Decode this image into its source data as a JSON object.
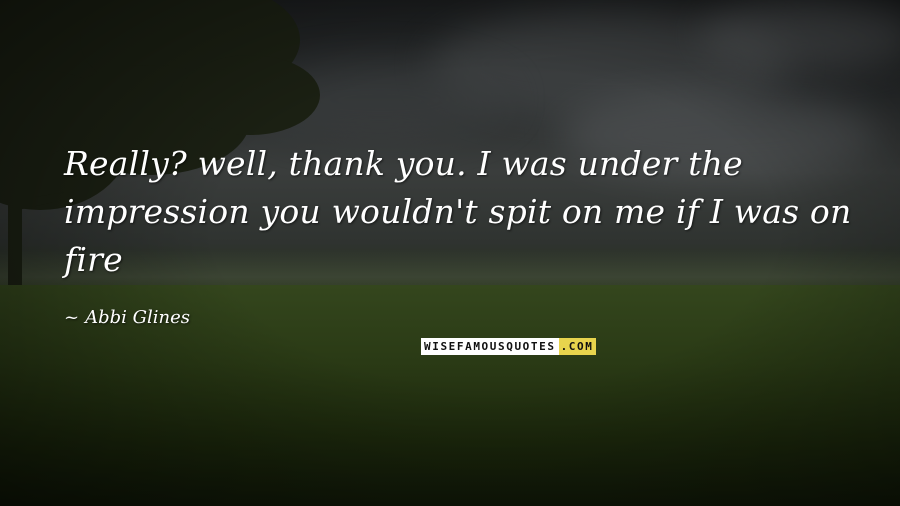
{
  "quote": {
    "text": "Really? well, thank you. I was under the impression you wouldn't spit on me if I was on fire",
    "author_dash": "~",
    "author": "Abbi Glines"
  },
  "watermark": {
    "main": "WISEFAMOUSQUOTES",
    "tld": ".COM"
  },
  "colors": {
    "text": "#ffffff",
    "watermark_bg": "#ffffff",
    "watermark_accent": "#e8d44d"
  }
}
